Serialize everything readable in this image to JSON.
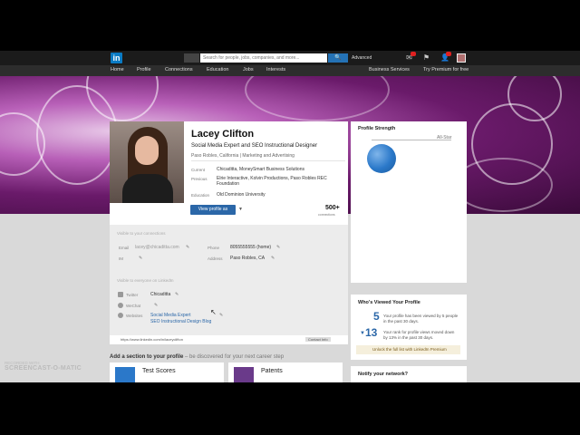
{
  "nav": {
    "logo": "in",
    "search_placeholder": "Search for people, jobs, companies, and more...",
    "search_button": "🔍",
    "advanced": "Advanced",
    "menu": [
      "Home",
      "Profile",
      "Connections",
      "Education",
      "Jobs",
      "Interests"
    ],
    "business_services": "Business Services",
    "premium": "Try Premium for free"
  },
  "profile": {
    "name": "Lacey Clifton",
    "headline": "Social Media Expert and SEO Instructional Designer",
    "location": "Paso Robles, California",
    "industry": "Marketing and Advertising",
    "current_label": "Current",
    "current": "Chicaditta, MoneySmart Business Solutions",
    "previous_label": "Previous",
    "previous": "Elrie Interactive, Kolvin Productions, Paso Robles REC Foundation",
    "education_label": "Education",
    "education": "Old Dominion University",
    "view_profile_button": "View profile as",
    "connections_count": "500+",
    "connections_label": "connections"
  },
  "contact": {
    "section_title": "Visible to your connections",
    "email_label": "Email",
    "email": "lacey@chicaditta.com",
    "im_label": "IM",
    "phone_label": "Phone",
    "phone": "8055555555 (home)",
    "address_label": "Address",
    "address": "Paso Robles, CA",
    "section2_title": "Visible to everyone on LinkedIn",
    "twitter_label": "Twitter",
    "twitter": "Chicaditta",
    "wechat_label": "WeChat",
    "websites_label": "Websites",
    "website1": "Social Media Expert",
    "website2": "SEO Instructional Design Blog"
  },
  "urlbar": {
    "url": "https://www.linkedin.com/in/laceyclifton",
    "contact_info": "Contact Info"
  },
  "add_section": {
    "bold": "Add a section to your profile",
    "rest": " – be discovered for your next career step",
    "tiles": [
      "Test Scores",
      "Patents"
    ]
  },
  "sidebar": {
    "strength_title": "Profile Strength",
    "strength_level": "All-Star",
    "who_viewed_title": "Who's Viewed Your Profile",
    "views_count": "5",
    "views_text": "Your profile has been viewed by 5 people in the past 30 days.",
    "rank_count": "13",
    "rank_text": "Your rank for profile views moved down by 13% in the past 30 days.",
    "premium_text": "Unlock the full list with LinkedIn Premium",
    "notify_title": "Notify your network?"
  },
  "watermark": {
    "line1": "RECORDED WITH",
    "line2": "SCREENCAST-O-MATIC"
  }
}
